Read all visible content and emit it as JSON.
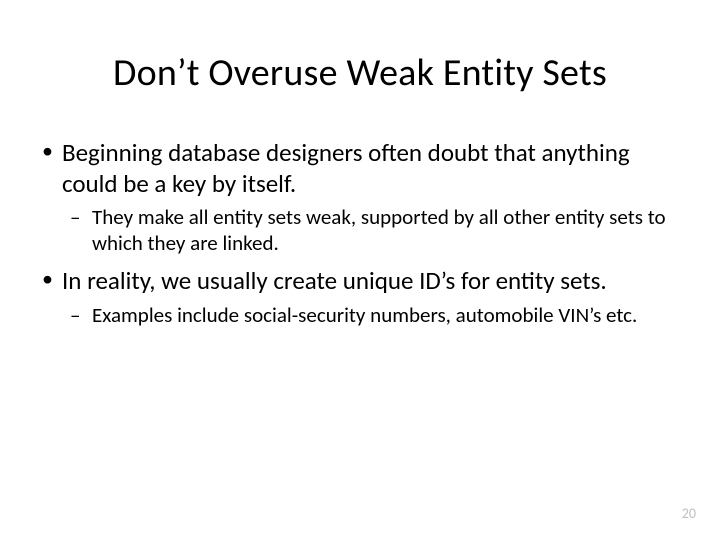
{
  "title": "Don’t Overuse Weak Entity Sets",
  "bullets": [
    {
      "text": "Beginning database designers often doubt that anything could be a key by itself.",
      "sub": [
        "They make all entity sets weak, supported by all other entity sets to which they are linked."
      ]
    },
    {
      "text": "In reality, we usually create unique ID’s for entity sets.",
      "sub": [
        "Examples include social-security numbers, automobile VIN’s etc."
      ]
    }
  ],
  "pageNumber": "20"
}
